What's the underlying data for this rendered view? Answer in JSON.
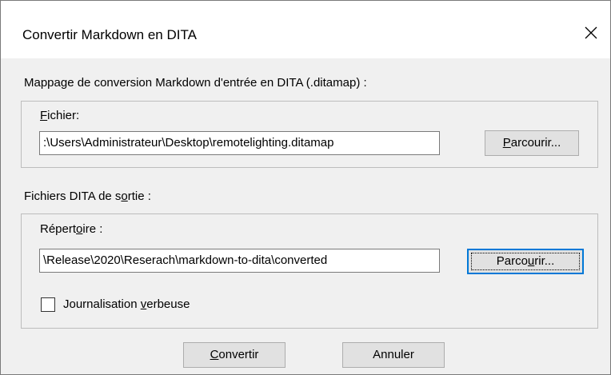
{
  "window": {
    "title": "Convertir Markdown en DITA",
    "close_glyph": "✕"
  },
  "input_section": {
    "heading": "Mappage de conversion Markdown d'entrée en DITA (.ditamap) :",
    "file_label_mnemonic": "F",
    "file_label_rest": "ichier:",
    "file_value": ":\\Users\\Administrateur\\Desktop\\remotelighting.ditamap",
    "browse_mnemonic": "P",
    "browse_rest": "arcourir..."
  },
  "output_section": {
    "heading_pre": "Fichiers DITA de s",
    "heading_mnemonic": "o",
    "heading_post": "rtie :",
    "dir_label_pre": "Répert",
    "dir_label_mnemonic": "o",
    "dir_label_post": "ire :",
    "dir_value": "\\Release\\2020\\Reserach\\markdown-to-dita\\converted",
    "browse_pre": "Parco",
    "browse_mnemonic": "u",
    "browse_post": "rir...",
    "verbose_pre": "Journalisation ",
    "verbose_mnemonic": "v",
    "verbose_post": "erbeuse",
    "verbose_checked": false
  },
  "footer": {
    "convert_mnemonic": "C",
    "convert_rest": "onvertir",
    "cancel_label": "Annuler"
  }
}
